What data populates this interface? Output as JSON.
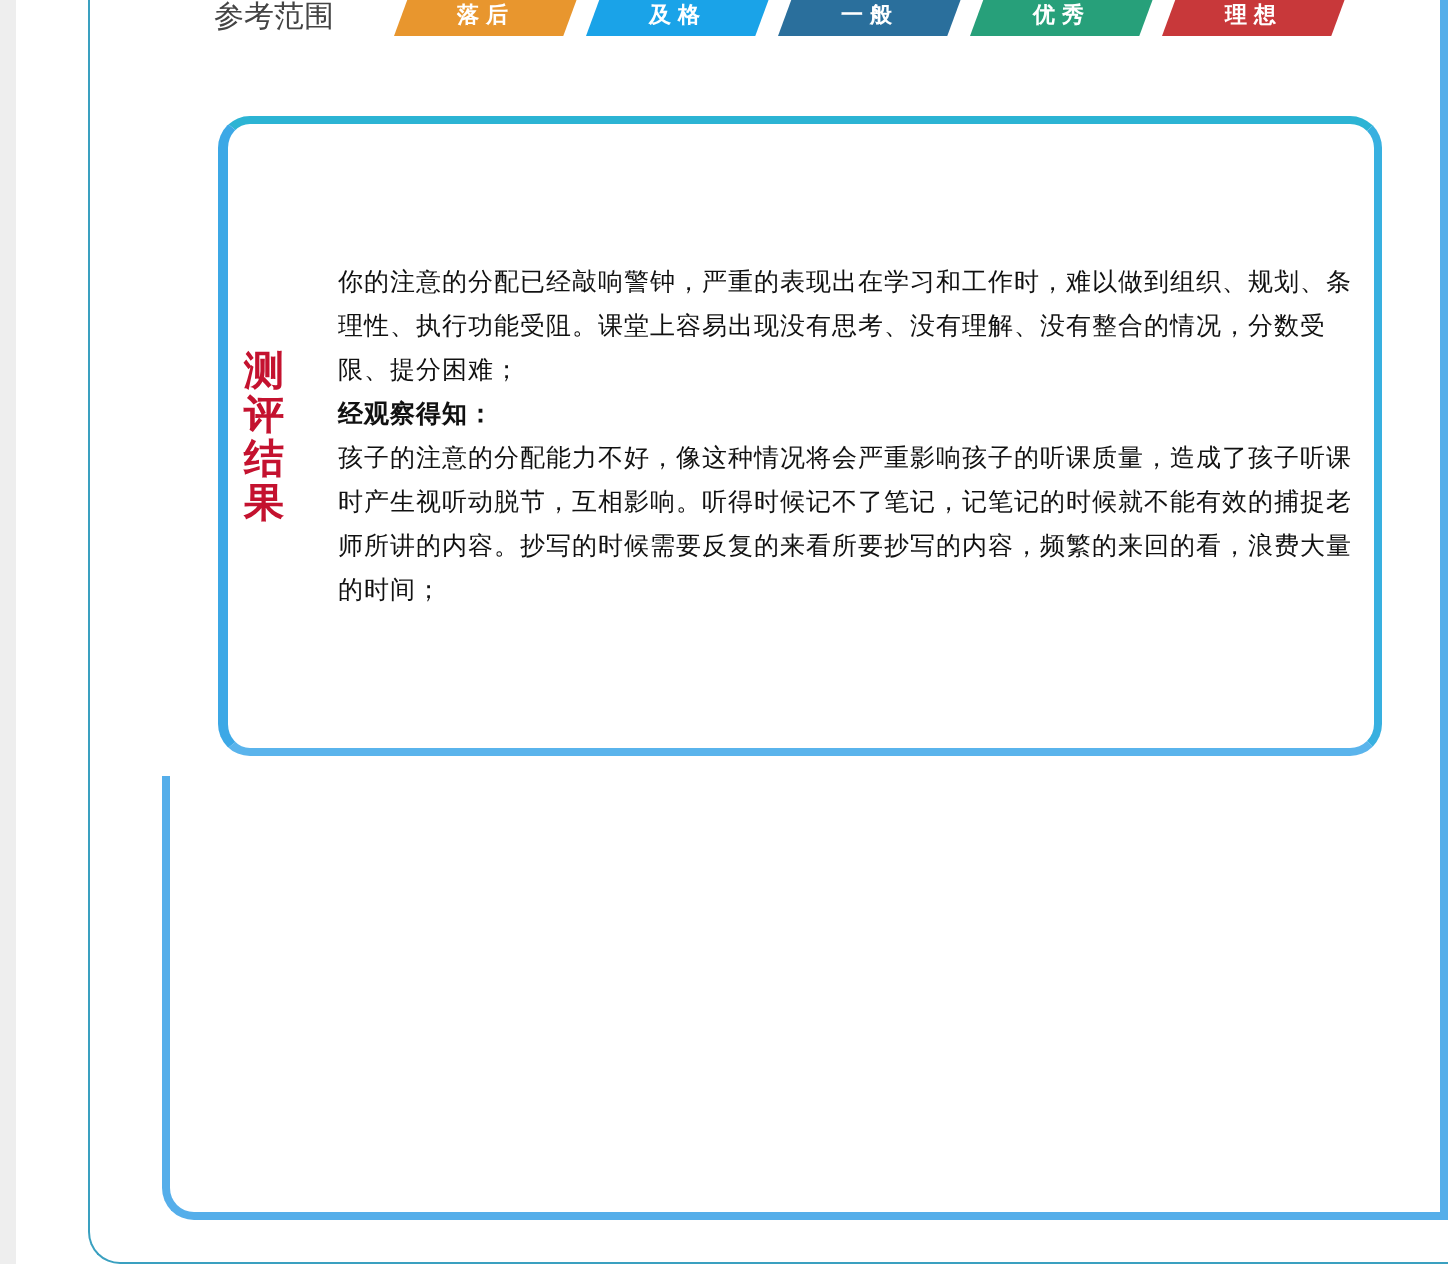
{
  "reference": {
    "label": "参考范围",
    "levels": [
      {
        "label": "落后",
        "color": "#e8962e"
      },
      {
        "label": "及格",
        "color": "#1aa3e8"
      },
      {
        "label": "一般",
        "color": "#2a6f9c"
      },
      {
        "label": "优秀",
        "color": "#27a07a"
      },
      {
        "label": "理想",
        "color": "#c8383a"
      }
    ]
  },
  "result": {
    "title": "测评结果",
    "blocks": [
      {
        "kind": "text",
        "text": "你的注意的分配已经敲响警钟，严重的表现出在学习和工作时，难以做到组织、规划、条理性、执行功能受阻。课堂上容易出现没有思考、没有理解、没有整合的情况，分数受限、提分困难；"
      },
      {
        "kind": "heading",
        "text": "经观察得知："
      },
      {
        "kind": "text",
        "text": "孩子的注意的分配能力不好，像这种情况将会严重影响孩子的听课质量，造成了孩子听课时产生视听动脱节，互相影响。听得时候记不了笔记，记笔记的时候就不能有效的捕捉老师所讲的内容。抄写的时候需要反复的来看所要抄写的内容，频繁的来回的看，浪费大量的时间；"
      }
    ]
  }
}
